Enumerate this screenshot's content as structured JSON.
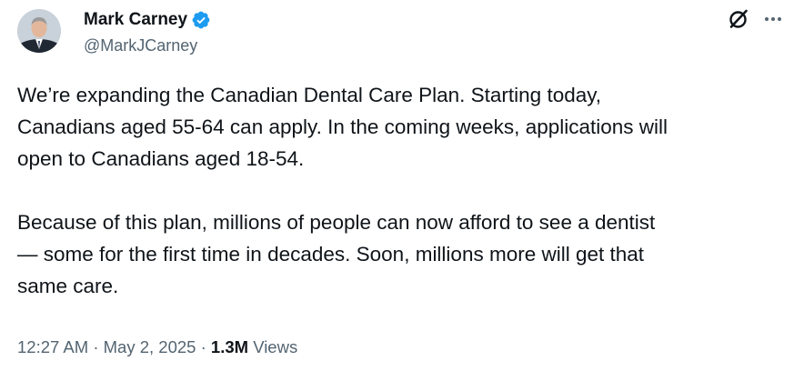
{
  "author": {
    "display_name": "Mark Carney",
    "handle": "@MarkJCarney",
    "verified": true,
    "verified_icon": "verified-badge-icon",
    "verified_color": "#1d9bf0"
  },
  "actions": {
    "grok_icon": "grok-icon",
    "more_icon": "more-options-icon"
  },
  "post": {
    "paragraph_1_lines": [
      "We’re expanding the Canadian Dental Care Plan. Starting today,",
      "Canadians aged 55-64 can apply. In the coming weeks, applications will",
      "open to Canadians aged 18-54."
    ],
    "paragraph_2_lines": [
      "Because of this plan, millions of people can now afford to see a dentist",
      "— some for the first time in decades. Soon, millions more will get that",
      "same care."
    ]
  },
  "meta": {
    "time": "12:27 AM",
    "separator": "·",
    "date": "May 2, 2025",
    "views_count": "1.3M",
    "views_label": "Views"
  },
  "colors": {
    "text": "#0f1419",
    "secondary": "#536471",
    "accent": "#1d9bf0"
  }
}
